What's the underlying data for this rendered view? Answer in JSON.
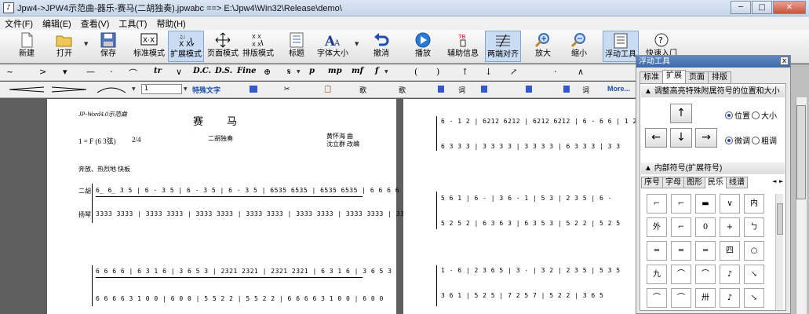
{
  "window": {
    "title": "Jpw4->JPW4示范曲-器乐-赛马(二胡独奏).jpwabc ==> E:\\Jpw4\\Win32\\Release\\demo\\",
    "app_icon": "score-icon",
    "buttons": {
      "minimize": "─",
      "maximize": "□",
      "close": "✕"
    }
  },
  "menu": [
    "文件(F)",
    "编辑(E)",
    "查看(V)",
    "工具(T)",
    "帮助(H)"
  ],
  "toolbar": {
    "new": "新建",
    "open": "打开",
    "save": "保存",
    "standard_mode": "标准模式",
    "expand_mode": "扩展模式",
    "page_mode": "页面模式",
    "layout_mode": "排版模式",
    "title": "标题",
    "font_size": "字体大小",
    "undo": "撤消",
    "play": "播放",
    "aux_info": "辅助信息",
    "justify": "两端对齐",
    "zoom_in": "放大",
    "zoom_out": "缩小",
    "float_tools": "浮动工具",
    "help": "快速入门"
  },
  "format_bar": {
    "symbols": [
      "~",
      ">",
      "▾",
      "—",
      "·",
      "⌒",
      "tr",
      "∨",
      "D.C.",
      "D.S.",
      "Fine",
      "⊕",
      "𝄋",
      "p",
      "mp",
      "mf",
      "f",
      "(",
      ")",
      "↑",
      "↓",
      "↗",
      "·",
      "∧"
    ]
  },
  "lyric_bar": {
    "step_value": "1",
    "special_text": "特殊文字",
    "song_label_1": "歌",
    "song_label_2": "歌",
    "word_label_1": "词",
    "word_label_2": "词",
    "more": "More..."
  },
  "panel": {
    "title": "浮动工具",
    "close": "x",
    "tabs": [
      "标准",
      "扩展",
      "页面",
      "排版"
    ],
    "active_tab": "扩展",
    "section1": "调整高亮特殊附属符号的位置和大小",
    "arrows": {
      "up": "↑",
      "left": "←",
      "down": "↓",
      "right": "→"
    },
    "radio_position": "位置",
    "radio_size": "大小",
    "radio_fine": "微调",
    "radio_coarse": "粗调",
    "section2": "内部符号(扩展符号)",
    "inner_tabs": [
      "序号",
      "字母",
      "图形",
      "民乐",
      "线谱"
    ],
    "active_inner_tab": "民乐",
    "cells": [
      "⌐",
      "⌐",
      "▬",
      "∨",
      "内",
      "外",
      "⌐",
      "0",
      "+",
      "ㄅ",
      "═",
      "═",
      "═",
      "四",
      "○",
      "九",
      "⌒",
      "⌒",
      "♪",
      "↘",
      "⌒",
      "⌒",
      "卅",
      "♪",
      "↘"
    ]
  },
  "score": {
    "header_small": "JP-Word4.0示范曲",
    "title": "赛马",
    "subtitle": "二胡独奏",
    "key": "1 = F (6 3弦)",
    "time": "2/4",
    "composer": "黄怀海 曲",
    "arranger": "沈立群 改编",
    "tempo": "奔放、热烈地 快板",
    "part1": "二胡",
    "part2": "扬琴",
    "p1_row1_top": "6̲ 6̲   3 5 | 6 ·   3 5 | 6 ·   3 5 | 6 ·   3 5 | 6535 6535 | 6535 6535 | 6 6 6 6",
    "p1_row1_bot": "3333 3333 | 3333 3333 | 3333 3333 | 3333 3333 | 3333 3333 | 3333 3333 | 3333 3333",
    "p1_row2_top": "6 6 6 6 | 6 3 1 6 | 3 6 5 3 | 2321 2321 | 2321 2321 | 6 3 1 6 | 3 6 5 3",
    "p1_row2_bot": "6 6 6 6 3 1 0 0 | 6 0 0 | 5 5 2 2 | 5 5 2 2 | 6 6 6 6 3 1 0 0 | 6 0 0",
    "p2_row1_top": "6 · 1 2 | 6212 6212 | 6212 6212 | 6 · 6 6 | 1 2",
    "p2_row1_bot": "6 3 3 3 | 3 3 3 3 | 3 3 3 3 | 6 3 3 3 | 3 3",
    "p2_row2_top": "5 6 1 | 6 - | 3 6 · 1 | 5 3 | 2 3 5 | 6 ·",
    "p2_row2_bot": "5 2 5 2 | 6 3 6 3 | 6 3 5 3 | 5 2 2 | 5 2 5",
    "p2_row3_top": "1 · 6 | 2 3 6 5 | 3 · | 3 2 | 2 3 5 | 5 3 5",
    "p2_row3_bot": "3 6 1 | 5 2 5 | 7 2 5 7 | 5 2 2 | 3 6 5"
  },
  "colors": {
    "accent": "#3d6aa8",
    "active_btn": "#c9dcf3",
    "link_blue": "#1b4fb0"
  }
}
